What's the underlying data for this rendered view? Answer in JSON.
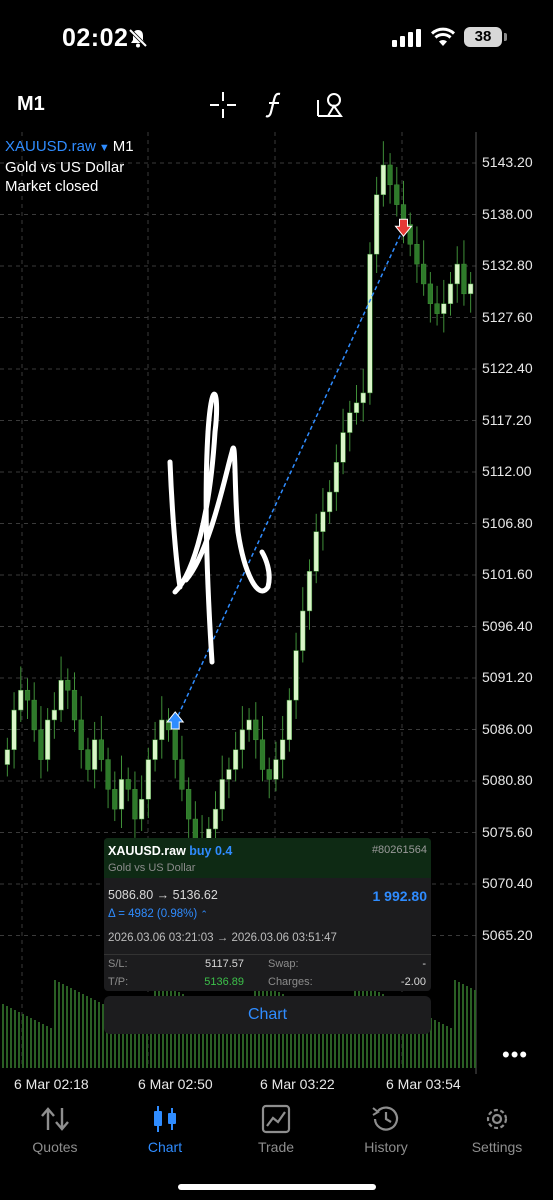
{
  "status_bar": {
    "time": "02:02",
    "battery": "38"
  },
  "toolbar": {
    "timeframe": "M1"
  },
  "symbol": {
    "name": "XAUUSD.raw",
    "timeframe": "M1",
    "description": "Gold vs US Dollar",
    "market_status": "Market closed"
  },
  "price_axis": [
    "5143.20",
    "5138.00",
    "5132.80",
    "5127.60",
    "5122.40",
    "5117.20",
    "5112.00",
    "5106.80",
    "5101.60",
    "5096.40",
    "5091.20",
    "5086.00",
    "5080.80",
    "5075.60",
    "5070.40",
    "5065.20"
  ],
  "time_axis": [
    "6 Mar 02:18",
    "6 Mar 02:50",
    "6 Mar 03:22",
    "6 Mar 03:54"
  ],
  "position": {
    "symbol": "XAUUSD.raw",
    "side": "buy 0.4",
    "description": "Gold vs US Dollar",
    "ticket": "#80261564",
    "open_price": "5086.80",
    "close_price": "5136.62",
    "arrow": "→",
    "profit": "1 992.80",
    "delta": "Δ = 4982 (0.98%)",
    "open_time": "2026.03.06 03:21:03",
    "close_time": "2026.03.06 03:51:47",
    "sl_label": "S/L:",
    "sl_value": "5117.57",
    "tp_label": "T/P:",
    "tp_value": "5136.89",
    "swap_label": "Swap:",
    "swap_value": "-",
    "charges_label": "Charges:",
    "charges_value": "-2.00"
  },
  "chart_button": "Chart",
  "more_label": "•••",
  "nav": [
    {
      "label": "Quotes",
      "active": false
    },
    {
      "label": "Chart",
      "active": true
    },
    {
      "label": "Trade",
      "active": false
    },
    {
      "label": "History",
      "active": false
    },
    {
      "label": "Settings",
      "active": false
    }
  ],
  "colors": {
    "accent": "#2f8cff",
    "bull_candle": "#d9f5c8",
    "bear_candle": "#2e7a2a",
    "tp": "#3cc04a",
    "grid": "#3a3a3a"
  },
  "chart_data": {
    "type": "candlestick",
    "symbol": "XAUUSD.raw",
    "ylim": [
      5062.6,
      5145.8
    ],
    "x_ticks": [
      "6 Mar 02:18",
      "6 Mar 02:50",
      "6 Mar 03:22",
      "6 Mar 03:54"
    ],
    "close_series": [
      5084,
      5088,
      5090,
      5089,
      5086,
      5083,
      5087,
      5088,
      5091,
      5090,
      5087,
      5084,
      5082,
      5085,
      5083,
      5080,
      5078,
      5081,
      5080,
      5077,
      5079,
      5083,
      5085,
      5087,
      5086,
      5083,
      5080,
      5077,
      5075,
      5074,
      5076,
      5078,
      5081,
      5082,
      5084,
      5086,
      5087,
      5085,
      5082,
      5081,
      5083,
      5085,
      5089,
      5094,
      5098,
      5102,
      5106,
      5108,
      5110,
      5113,
      5116,
      5118,
      5119,
      5120,
      5134,
      5140,
      5143,
      5141,
      5139,
      5137,
      5135,
      5133,
      5131,
      5129,
      5128,
      5129,
      5131,
      5133,
      5130,
      5131
    ],
    "trade": {
      "side": "buy",
      "entry": 5086.8,
      "exit": 5136.62,
      "entry_index": 25,
      "exit_index": 59
    }
  }
}
